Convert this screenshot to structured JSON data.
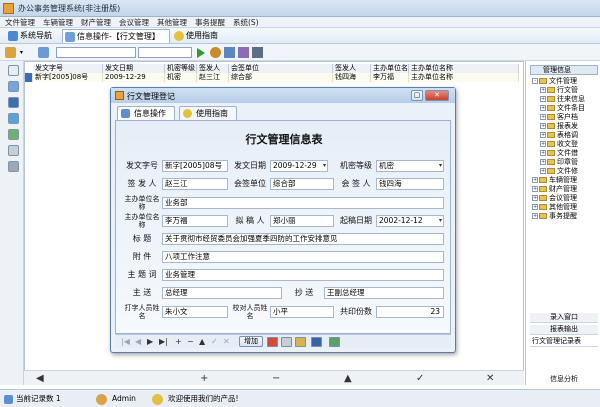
{
  "window": {
    "title": "办公事务管理系统(非注册版)"
  },
  "menu": [
    "文件管理",
    "车辆管理",
    "财产管理",
    "会议管理",
    "其他管理",
    "事务提醒",
    "系统(S)"
  ],
  "tabs": [
    "系统导航",
    "信息操作-【行文管理】",
    "使用指南"
  ],
  "grid": {
    "headers": [
      "发文字号",
      "发文日期",
      "机密等级",
      "签发人",
      "会签单位",
      "签发人",
      "主办单位名",
      "主办单位名称"
    ],
    "row": [
      "新字[2005]08号",
      "2009-12-29",
      "机密",
      "赵三江",
      "综合部",
      "钱四海",
      "李万福",
      "主办单位名称"
    ]
  },
  "right_panel": {
    "header": "管理信息",
    "tree": [
      {
        "label": "文件管理",
        "level": 0,
        "expand": "-"
      },
      {
        "label": "行文管",
        "level": 1,
        "expand": "+"
      },
      {
        "label": "往来信息",
        "level": 1,
        "expand": "+"
      },
      {
        "label": "文件条目",
        "level": 1,
        "expand": "+"
      },
      {
        "label": "客户档",
        "level": 1,
        "expand": "+"
      },
      {
        "label": "报表发",
        "level": 1,
        "expand": "+"
      },
      {
        "label": "表格调",
        "level": 1,
        "expand": "+"
      },
      {
        "label": "收文登",
        "level": 1,
        "expand": "+"
      },
      {
        "label": "文件借",
        "level": 1,
        "expand": "+"
      },
      {
        "label": "印章管",
        "level": 1,
        "expand": "+"
      },
      {
        "label": "文件修",
        "level": 1,
        "expand": "+"
      },
      {
        "label": "车辆管理",
        "level": 0,
        "expand": "+"
      },
      {
        "label": "财产管理",
        "level": 0,
        "expand": "+"
      },
      {
        "label": "会议管理",
        "level": 0,
        "expand": "+"
      },
      {
        "label": "其他管理",
        "level": 0,
        "expand": "+"
      },
      {
        "label": "事务提醒",
        "level": 0,
        "expand": "+"
      }
    ],
    "records_window": "录入窗口",
    "report_output": "报表输出",
    "output_title": "行文管理记录表",
    "info_analysis": "信息分析"
  },
  "navbar": [
    "◀",
    "+",
    "−",
    "▲",
    "✓",
    "✕"
  ],
  "status": {
    "current_record": "当前记录数 1",
    "user": "Admin",
    "welcome": "欢迎使用我们的产品!"
  },
  "dialog": {
    "title": "行文管理登记",
    "tabs": [
      "信息操作",
      "使用指南"
    ],
    "form_title": "行文管理信息表",
    "fields": {
      "doc_no_label": "发文字号",
      "doc_no": "新字[2005]08号",
      "date_label": "发文日期",
      "date": "2009-12-29",
      "secret_label": "机密等级",
      "secret": "机密",
      "signer_label": "签 发 人",
      "signer": "赵三江",
      "co_unit_label": "会签单位",
      "co_unit": "综合部",
      "co_signer_label": "会 签 人",
      "co_signer": "钱四海",
      "host_unit_label": "主办单位名称",
      "host_unit": "业务部",
      "host_person_label": "主办单位名称",
      "host_person": "李万福",
      "drafter_label": "拟 稿 人",
      "drafter": "郑小丽",
      "draft_date_label": "起稿日期",
      "draft_date": "2002-12-12",
      "subject_label": "标    题",
      "subject": "关于贯彻市经贸委员会加强夏季四防的工作安排意见",
      "attach_label": "附    件",
      "attach": "八项工作注意",
      "keywords_label": "主 题 词",
      "keywords": "业务管理",
      "send_label": "主    送",
      "send": "总经理",
      "cc_label": "抄    送",
      "cc": "王副总经理",
      "typist_label": "打字人员姓名",
      "typist": "朱小文",
      "proofer_label": "校对人员姓名",
      "proofer": "小平",
      "copies_label": "共印份数",
      "copies": "23"
    },
    "nav_add": "增加"
  }
}
